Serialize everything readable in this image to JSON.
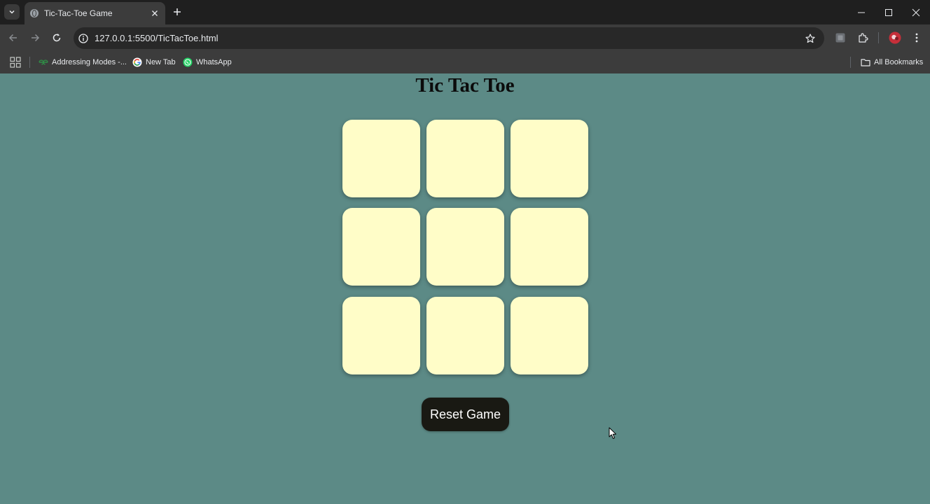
{
  "browser": {
    "tab_title": "Tic-Tac-Toe Game",
    "url": "127.0.0.1:5500/TicTacToe.html",
    "bookmarks": [
      {
        "label": "Addressing Modes -...",
        "icon": "geeksforgeeks-icon"
      },
      {
        "label": "New Tab",
        "icon": "google-icon"
      },
      {
        "label": "WhatsApp",
        "icon": "whatsapp-icon"
      }
    ],
    "all_bookmarks_label": "All Bookmarks"
  },
  "game": {
    "title": "Tic Tac Toe",
    "cells": [
      "",
      "",
      "",
      "",
      "",
      "",
      "",
      "",
      ""
    ],
    "reset_label": "Reset Game"
  },
  "colors": {
    "background": "#5c8a86",
    "cell": "#fffdc8",
    "button": "#191913"
  }
}
